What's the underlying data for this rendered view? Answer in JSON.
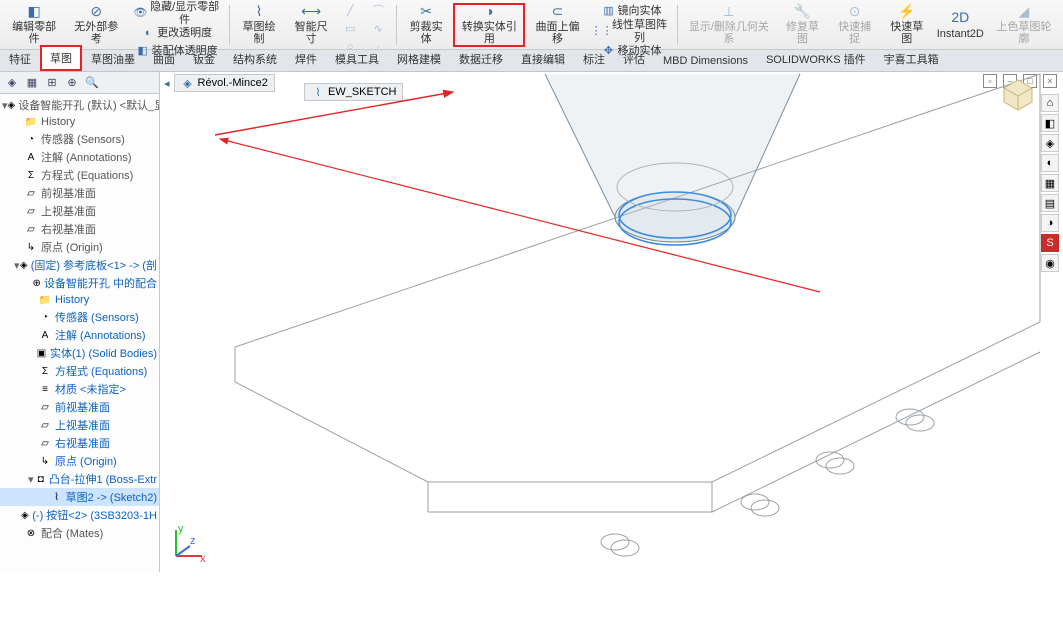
{
  "ribbon": {
    "editPart": "编辑零部件",
    "noExt": "无外部参考",
    "hideShow": "隐藏/显示零部件",
    "transparency": "更改透明度",
    "asmTrans": "装配体透明度",
    "sketch": "草图绘制",
    "smartDim": "智能尺寸",
    "convert": "转换实体引用",
    "trim": "剪裁实体",
    "offset": "曲面上偏移",
    "mirror": "镜向实体",
    "showDel": "显示/删除几何关系",
    "repair": "修复草图",
    "quickSnap": "快速捕捉",
    "quickSketch": "快速草图",
    "instant2d": "Instant2D",
    "color": "上色草图轮廓",
    "linPat": "线性草图阵列",
    "moveEnt": "移动实体"
  },
  "tabs": [
    "特征",
    "草图",
    "草图油墨",
    "曲面",
    "钣金",
    "结构系统",
    "焊件",
    "模具工具",
    "网格建模",
    "数据迁移",
    "直接编辑",
    "标注",
    "评估",
    "MBD Dimensions",
    "SOLIDWORKS 插件",
    "宇喜工具箱"
  ],
  "activeTab": 1,
  "breadcrumb": {
    "model": "Révol.-Mince2",
    "sketch": "EW_SKETCH"
  },
  "tree": {
    "root": "设备智能开孔 (默认) <默认_显",
    "items": [
      {
        "t": "History",
        "i": "📁"
      },
      {
        "t": "传感器 (Sensors)",
        "i": "◔"
      },
      {
        "t": "注解 (Annotations)",
        "i": "A"
      },
      {
        "t": "方程式 (Equations)",
        "i": "Σ"
      },
      {
        "t": "前视基准面",
        "i": "▱"
      },
      {
        "t": "上视基准面",
        "i": "▱"
      },
      {
        "t": "右视基准面",
        "i": "▱"
      },
      {
        "t": "原点 (Origin)",
        "i": "↳"
      },
      {
        "t": "(固定) 参考底板<1> -> (剖",
        "i": "◈",
        "c": "blue",
        "exp": true,
        "children": [
          {
            "t": "设备智能开孔 中的配合",
            "i": "⊕",
            "c": "blue"
          },
          {
            "t": "History",
            "i": "📁",
            "c": "blue"
          },
          {
            "t": "传感器 (Sensors)",
            "i": "◔",
            "c": "blue"
          },
          {
            "t": "注解 (Annotations)",
            "i": "A",
            "c": "blue"
          },
          {
            "t": "实体(1) (Solid Bodies)",
            "i": "▣",
            "c": "blue"
          },
          {
            "t": "方程式 (Equations)",
            "i": "Σ",
            "c": "blue"
          },
          {
            "t": "材质 <未指定>",
            "i": "≡",
            "c": "blue"
          },
          {
            "t": "前视基准面",
            "i": "▱",
            "c": "blue"
          },
          {
            "t": "上视基准面",
            "i": "▱",
            "c": "blue"
          },
          {
            "t": "右视基准面",
            "i": "▱",
            "c": "blue"
          },
          {
            "t": "原点 (Origin)",
            "i": "↳",
            "c": "blue"
          },
          {
            "t": "凸台-拉伸1 (Boss-Extr",
            "i": "◘",
            "c": "blue",
            "exp": true,
            "children": [
              {
                "t": "草图2 -> (Sketch2)",
                "i": "⌇",
                "c": "blue",
                "sel": true
              }
            ]
          }
        ]
      },
      {
        "t": "(-) 按钮<2> (3SB3203-1H",
        "i": "◈",
        "c": "blue"
      },
      {
        "t": "配合 (Mates)",
        "i": "⊗"
      }
    ]
  },
  "rightTools": [
    "⌂",
    "◧",
    "◈",
    "◐",
    "▦",
    "▤",
    "◑",
    "S",
    "◉"
  ],
  "triad": {
    "x": "x",
    "y": "y",
    "z": "z"
  }
}
